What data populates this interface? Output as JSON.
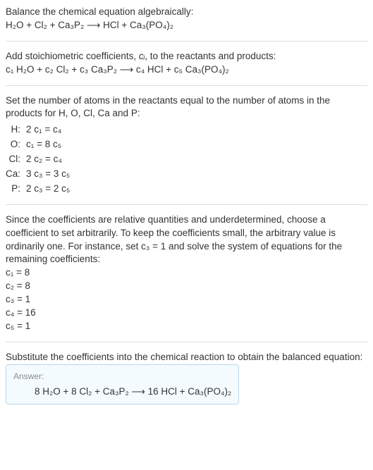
{
  "chart_data": {
    "type": "table",
    "title": "Atom balance equations",
    "rows": [
      {
        "element": "H",
        "equation": "2 c1 = c4"
      },
      {
        "element": "O",
        "equation": "c1 = 8 c5"
      },
      {
        "element": "Cl",
        "equation": "2 c2 = c4"
      },
      {
        "element": "Ca",
        "equation": "3 c3 = 3 c5"
      },
      {
        "element": "P",
        "equation": "2 c3 = 2 c5"
      }
    ],
    "solution": {
      "c1": 8,
      "c2": 8,
      "c3": 1,
      "c4": 16,
      "c5": 1
    }
  },
  "sec1": {
    "line1": "Balance the chemical equation algebraically:",
    "eq": "H₂O + Cl₂ + Ca₃P₂  ⟶  HCl + Ca₃(PO₄)₂"
  },
  "sec2": {
    "line1_a": "Add stoichiometric coefficients, ",
    "line1_ci": "cᵢ",
    "line1_b": ", to the reactants and products:",
    "eq": "c₁ H₂O + c₂ Cl₂ + c₃ Ca₃P₂  ⟶  c₄ HCl + c₅ Ca₃(PO₄)₂"
  },
  "sec3": {
    "intro": "Set the number of atoms in the reactants equal to the number of atoms in the products for H, O, Cl, Ca and P:",
    "rows": [
      {
        "label": "H:",
        "eq": "2 c₁ = c₄"
      },
      {
        "label": "O:",
        "eq": "c₁ = 8 c₅"
      },
      {
        "label": "Cl:",
        "eq": "2 c₂ = c₄"
      },
      {
        "label": "Ca:",
        "eq": "3 c₃ = 3 c₅"
      },
      {
        "label": "P:",
        "eq": "2 c₃ = 2 c₅"
      }
    ]
  },
  "sec4": {
    "intro": "Since the coefficients are relative quantities and underdetermined, choose a coefficient to set arbitrarily. To keep the coefficients small, the arbitrary value is ordinarily one. For instance, set c₃ = 1 and solve the system of equations for the remaining coefficients:",
    "lines": [
      "c₁ = 8",
      "c₂ = 8",
      "c₃ = 1",
      "c₄ = 16",
      "c₅ = 1"
    ]
  },
  "sec5": {
    "intro": "Substitute the coefficients into the chemical reaction to obtain the balanced equation:",
    "answer_label": "Answer:",
    "answer": "8 H₂O + 8 Cl₂ + Ca₃P₂  ⟶  16 HCl + Ca₃(PO₄)₂"
  }
}
